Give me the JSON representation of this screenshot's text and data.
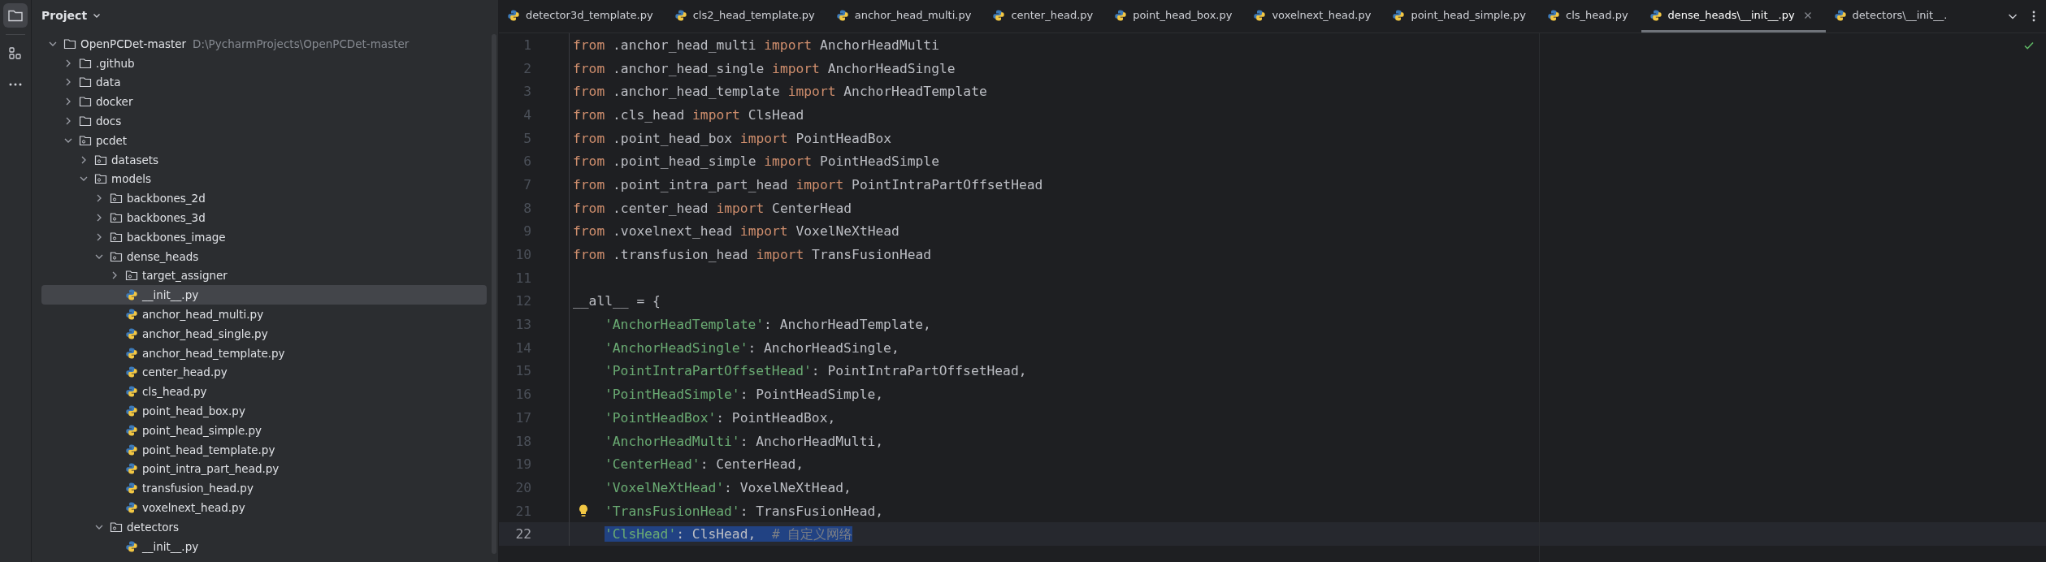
{
  "project_panel": {
    "title": "Project",
    "tree": [
      {
        "name": "OpenPCDet-master",
        "kind": "folder",
        "path": "D:\\PycharmProjects\\OpenPCDet-master",
        "expanded": true,
        "selected": false,
        "children": [
          {
            "name": ".github",
            "kind": "folder",
            "expanded": false,
            "selected": false
          },
          {
            "name": "data",
            "kind": "folder",
            "expanded": false,
            "selected": false
          },
          {
            "name": "docker",
            "kind": "folder",
            "expanded": false,
            "selected": false
          },
          {
            "name": "docs",
            "kind": "folder",
            "expanded": false,
            "selected": false
          },
          {
            "name": "pcdet",
            "kind": "package",
            "expanded": true,
            "selected": false,
            "children": [
              {
                "name": "datasets",
                "kind": "package",
                "expanded": false,
                "selected": false
              },
              {
                "name": "models",
                "kind": "package",
                "expanded": true,
                "selected": false,
                "children": [
                  {
                    "name": "backbones_2d",
                    "kind": "package",
                    "expanded": false,
                    "selected": false
                  },
                  {
                    "name": "backbones_3d",
                    "kind": "package",
                    "expanded": false,
                    "selected": false
                  },
                  {
                    "name": "backbones_image",
                    "kind": "package",
                    "expanded": false,
                    "selected": false
                  },
                  {
                    "name": "dense_heads",
                    "kind": "package",
                    "expanded": true,
                    "selected": false,
                    "children": [
                      {
                        "name": "target_assigner",
                        "kind": "package",
                        "expanded": false,
                        "selected": false
                      },
                      {
                        "name": "__init__.py",
                        "kind": "python",
                        "selected": true
                      },
                      {
                        "name": "anchor_head_multi.py",
                        "kind": "python",
                        "selected": false
                      },
                      {
                        "name": "anchor_head_single.py",
                        "kind": "python",
                        "selected": false
                      },
                      {
                        "name": "anchor_head_template.py",
                        "kind": "python",
                        "selected": false
                      },
                      {
                        "name": "center_head.py",
                        "kind": "python",
                        "selected": false
                      },
                      {
                        "name": "cls_head.py",
                        "kind": "python",
                        "selected": false
                      },
                      {
                        "name": "point_head_box.py",
                        "kind": "python",
                        "selected": false
                      },
                      {
                        "name": "point_head_simple.py",
                        "kind": "python",
                        "selected": false
                      },
                      {
                        "name": "point_head_template.py",
                        "kind": "python",
                        "selected": false
                      },
                      {
                        "name": "point_intra_part_head.py",
                        "kind": "python",
                        "selected": false
                      },
                      {
                        "name": "transfusion_head.py",
                        "kind": "python",
                        "selected": false
                      },
                      {
                        "name": "voxelnext_head.py",
                        "kind": "python",
                        "selected": false
                      }
                    ]
                  },
                  {
                    "name": "detectors",
                    "kind": "package",
                    "expanded": true,
                    "selected": false,
                    "children": [
                      {
                        "name": "__init__.py",
                        "kind": "python",
                        "selected": false
                      }
                    ]
                  }
                ]
              }
            ]
          }
        ]
      }
    ]
  },
  "tabs": [
    {
      "label": "detector3d_template.py",
      "selected": false
    },
    {
      "label": "cls2_head_template.py",
      "selected": false
    },
    {
      "label": "anchor_head_multi.py",
      "selected": false
    },
    {
      "label": "center_head.py",
      "selected": false
    },
    {
      "label": "point_head_box.py",
      "selected": false
    },
    {
      "label": "voxelnext_head.py",
      "selected": false
    },
    {
      "label": "point_head_simple.py",
      "selected": false
    },
    {
      "label": "cls_head.py",
      "selected": false
    },
    {
      "label": "dense_heads\\__init__.py",
      "selected": true
    },
    {
      "label": "detectors\\__init__.",
      "selected": false
    }
  ],
  "editor": {
    "lines": [
      {
        "number": "1",
        "current": false,
        "hint": false,
        "indented": false,
        "tokens": [
          {
            "kind": "keyword",
            "text": "from"
          },
          {
            "kind": "plain",
            "text": " .anchor_head_multi "
          },
          {
            "kind": "keyword",
            "text": "import"
          },
          {
            "kind": "plain",
            "text": " AnchorHeadMulti"
          }
        ]
      },
      {
        "number": "2",
        "current": false,
        "hint": false,
        "indented": false,
        "tokens": [
          {
            "kind": "keyword",
            "text": "from"
          },
          {
            "kind": "plain",
            "text": " .anchor_head_single "
          },
          {
            "kind": "keyword",
            "text": "import"
          },
          {
            "kind": "plain",
            "text": " AnchorHeadSingle"
          }
        ]
      },
      {
        "number": "3",
        "current": false,
        "hint": false,
        "indented": false,
        "tokens": [
          {
            "kind": "keyword",
            "text": "from"
          },
          {
            "kind": "plain",
            "text": " .anchor_head_template "
          },
          {
            "kind": "keyword",
            "text": "import"
          },
          {
            "kind": "plain",
            "text": " AnchorHeadTemplate"
          }
        ]
      },
      {
        "number": "4",
        "current": false,
        "hint": false,
        "indented": false,
        "tokens": [
          {
            "kind": "keyword",
            "text": "from"
          },
          {
            "kind": "plain",
            "text": " .cls_head "
          },
          {
            "kind": "keyword",
            "text": "import"
          },
          {
            "kind": "plain",
            "text": " ClsHead"
          }
        ]
      },
      {
        "number": "5",
        "current": false,
        "hint": false,
        "indented": false,
        "tokens": [
          {
            "kind": "keyword",
            "text": "from"
          },
          {
            "kind": "plain",
            "text": " .point_head_box "
          },
          {
            "kind": "keyword",
            "text": "import"
          },
          {
            "kind": "plain",
            "text": " PointHeadBox"
          }
        ]
      },
      {
        "number": "6",
        "current": false,
        "hint": false,
        "indented": false,
        "tokens": [
          {
            "kind": "keyword",
            "text": "from"
          },
          {
            "kind": "plain",
            "text": " .point_head_simple "
          },
          {
            "kind": "keyword",
            "text": "import"
          },
          {
            "kind": "plain",
            "text": " PointHeadSimple"
          }
        ]
      },
      {
        "number": "7",
        "current": false,
        "hint": false,
        "indented": false,
        "tokens": [
          {
            "kind": "keyword",
            "text": "from"
          },
          {
            "kind": "plain",
            "text": " .point_intra_part_head "
          },
          {
            "kind": "keyword",
            "text": "import"
          },
          {
            "kind": "plain",
            "text": " PointIntraPartOffsetHead"
          }
        ]
      },
      {
        "number": "8",
        "current": false,
        "hint": false,
        "indented": false,
        "tokens": [
          {
            "kind": "keyword",
            "text": "from"
          },
          {
            "kind": "plain",
            "text": " .center_head "
          },
          {
            "kind": "keyword",
            "text": "import"
          },
          {
            "kind": "plain",
            "text": " CenterHead"
          }
        ]
      },
      {
        "number": "9",
        "current": false,
        "hint": false,
        "indented": false,
        "tokens": [
          {
            "kind": "keyword",
            "text": "from"
          },
          {
            "kind": "plain",
            "text": " .voxelnext_head "
          },
          {
            "kind": "keyword",
            "text": "import"
          },
          {
            "kind": "plain",
            "text": " VoxelNeXtHead"
          }
        ]
      },
      {
        "number": "10",
        "current": false,
        "hint": false,
        "indented": false,
        "tokens": [
          {
            "kind": "keyword",
            "text": "from"
          },
          {
            "kind": "plain",
            "text": " .transfusion_head "
          },
          {
            "kind": "keyword",
            "text": "import"
          },
          {
            "kind": "plain",
            "text": " TransFusionHead"
          }
        ]
      },
      {
        "number": "11",
        "current": false,
        "hint": false
      },
      {
        "number": "12",
        "current": false,
        "hint": false,
        "indented": false,
        "tokens": [
          {
            "kind": "plain",
            "text": "__all__ = {"
          }
        ]
      },
      {
        "number": "13",
        "current": false,
        "hint": false,
        "indented": true,
        "tokens": [
          {
            "kind": "string",
            "text": "'AnchorHeadTemplate'"
          },
          {
            "kind": "plain",
            "text": ": AnchorHeadTemplate,"
          }
        ]
      },
      {
        "number": "14",
        "current": false,
        "hint": false,
        "indented": true,
        "tokens": [
          {
            "kind": "string",
            "text": "'AnchorHeadSingle'"
          },
          {
            "kind": "plain",
            "text": ": AnchorHeadSingle,"
          }
        ]
      },
      {
        "number": "15",
        "current": false,
        "hint": false,
        "indented": true,
        "tokens": [
          {
            "kind": "string",
            "text": "'PointIntraPartOffsetHead'"
          },
          {
            "kind": "plain",
            "text": ": PointIntraPartOffsetHead,"
          }
        ]
      },
      {
        "number": "16",
        "current": false,
        "hint": false,
        "indented": true,
        "tokens": [
          {
            "kind": "string",
            "text": "'PointHeadSimple'"
          },
          {
            "kind": "plain",
            "text": ": PointHeadSimple,"
          }
        ]
      },
      {
        "number": "17",
        "current": false,
        "hint": false,
        "indented": true,
        "tokens": [
          {
            "kind": "string",
            "text": "'PointHeadBox'"
          },
          {
            "kind": "plain",
            "text": ": PointHeadBox,"
          }
        ]
      },
      {
        "number": "18",
        "current": false,
        "hint": false,
        "indented": true,
        "tokens": [
          {
            "kind": "string",
            "text": "'AnchorHeadMulti'"
          },
          {
            "kind": "plain",
            "text": ": AnchorHeadMulti,"
          }
        ]
      },
      {
        "number": "19",
        "current": false,
        "hint": false,
        "indented": true,
        "tokens": [
          {
            "kind": "string",
            "text": "'CenterHead'"
          },
          {
            "kind": "plain",
            "text": ": CenterHead,"
          }
        ]
      },
      {
        "number": "20",
        "current": false,
        "hint": false,
        "indented": true,
        "tokens": [
          {
            "kind": "string",
            "text": "'VoxelNeXtHead'"
          },
          {
            "kind": "plain",
            "text": ": VoxelNeXtHead,"
          }
        ]
      },
      {
        "number": "21",
        "current": false,
        "hint": true,
        "indented": true,
        "tokens": [
          {
            "kind": "string",
            "text": "'TransFusionHead'"
          },
          {
            "kind": "plain",
            "text": ": TransFusionHead,"
          }
        ]
      },
      {
        "number": "22",
        "current": true,
        "hint": false,
        "indented": true,
        "tokens": [
          {
            "kind": "string",
            "text": "'ClsHead'",
            "selected": true
          },
          {
            "kind": "plain",
            "text": ": ClsHead,  ",
            "selected": true
          },
          {
            "kind": "comment",
            "text": "# 自定义网络",
            "selected": true
          }
        ]
      }
    ]
  }
}
